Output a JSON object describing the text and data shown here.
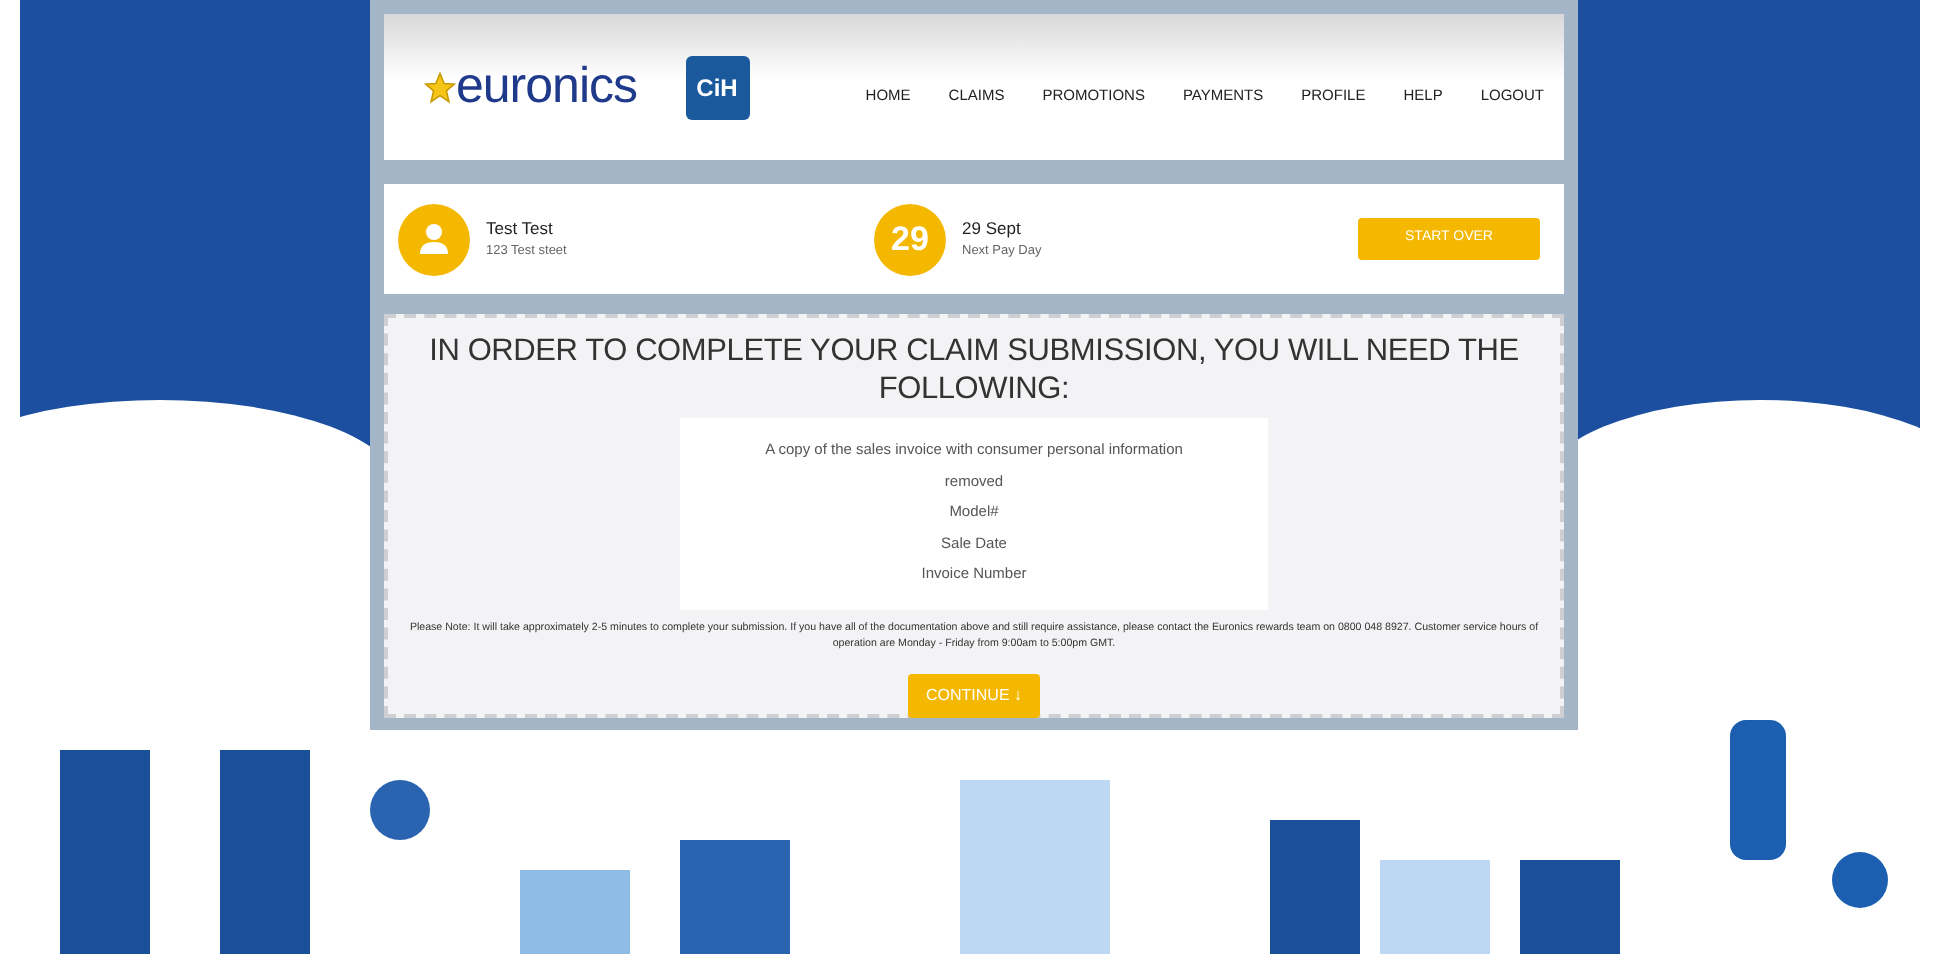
{
  "brand": {
    "logo": "euronics",
    "badge": "CiH"
  },
  "nav": [
    {
      "label": "HOME"
    },
    {
      "label": "CLAIMS"
    },
    {
      "label": "PROMOTIONS"
    },
    {
      "label": "PAYMENTS"
    },
    {
      "label": "PROFILE"
    },
    {
      "label": "HELP"
    },
    {
      "label": "LOGOUT"
    }
  ],
  "user": {
    "name": "Test Test",
    "address": "123 Test steet"
  },
  "payday": {
    "day": "29",
    "date": "29 Sept",
    "label": "Next Pay Day"
  },
  "start_over": "START OVER",
  "heading": "IN ORDER TO COMPLETE YOUR CLAIM SUBMISSION, YOU WILL NEED THE FOLLOWING:",
  "requirements": [
    "A copy of the sales invoice with consumer personal information",
    "removed",
    "Model#",
    "Sale Date",
    "Invoice Number"
  ],
  "note": "Please Note: It will take approximately 2-5 minutes to complete your submission. If you have all of the documentation above and still require assistance, please contact the Euronics rewards team on 0800 048 8927. Customer service hours of operation are Monday - Friday from 9:00am to 5:00pm GMT.",
  "continue": {
    "label": "CONTINUE",
    "icon": "↓"
  }
}
